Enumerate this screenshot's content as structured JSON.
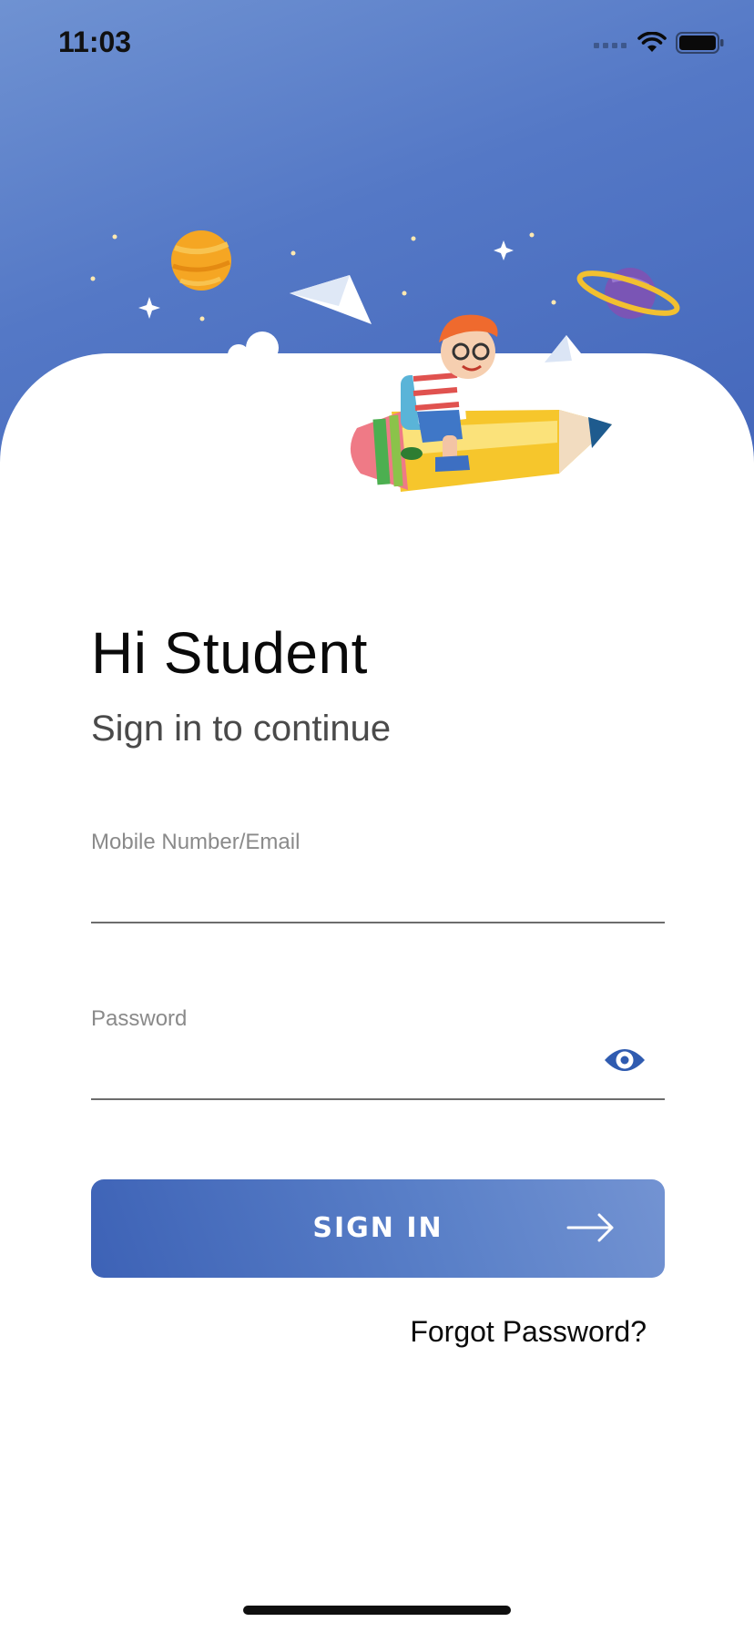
{
  "status_bar": {
    "time": "11:03"
  },
  "login": {
    "greeting": "Hi Student",
    "subtitle": "Sign in to continue",
    "username_label": "Mobile Number/Email",
    "username_value": "",
    "password_label": "Password",
    "password_value": "",
    "sign_in_label": "SIGN IN",
    "forgot_password_label": "Forgot Password?"
  },
  "colors": {
    "header_gradient_start": "#6f92d2",
    "header_gradient_end": "#4467bb",
    "primary": "#3d62b6",
    "eye_icon": "#2f5bb0"
  },
  "icons": [
    "signal-icon",
    "wifi-icon",
    "battery-icon",
    "eye-icon",
    "arrow-right-icon"
  ]
}
